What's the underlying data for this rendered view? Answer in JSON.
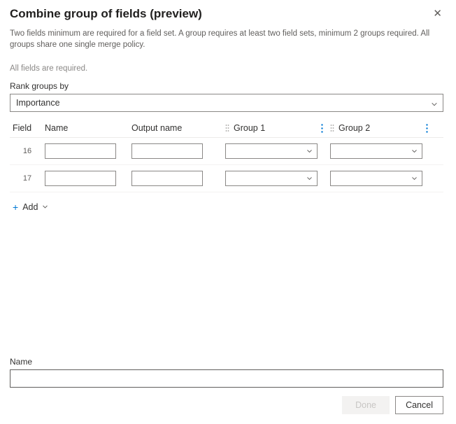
{
  "title": "Combine group of fields (preview)",
  "helper_text": "Two fields minimum are required for a field set. A group requires at least two field sets, minimum 2 groups required. All groups share one single merge policy.",
  "all_required": "All fields are required.",
  "rank_label": "Rank groups by",
  "rank_value": "Importance",
  "columns": {
    "field": "Field",
    "name": "Name",
    "output": "Output name",
    "g1": "Group 1",
    "g2": "Group 2"
  },
  "rows": [
    {
      "index": "16",
      "name": "",
      "output": "",
      "g1": "",
      "g2": ""
    },
    {
      "index": "17",
      "name": "",
      "output": "",
      "g1": "",
      "g2": ""
    }
  ],
  "add_label": "Add",
  "name_label": "Name",
  "name_value": "",
  "buttons": {
    "done": "Done",
    "cancel": "Cancel"
  }
}
